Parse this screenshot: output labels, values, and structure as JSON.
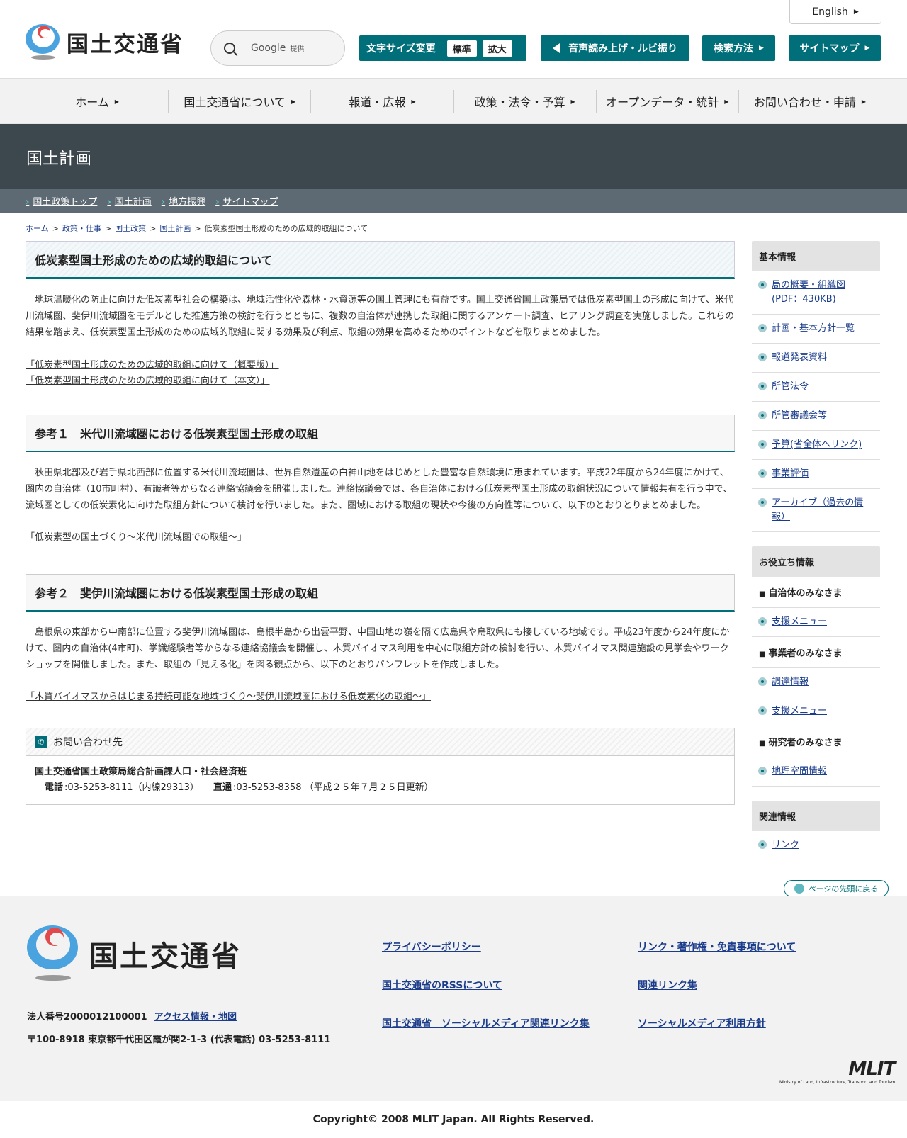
{
  "header": {
    "site_name": "国土交通省",
    "search_label": "Google",
    "search_suffix": "提供",
    "english": "English",
    "font_size_label": "文字サイズ変更",
    "font_size_std": "標準",
    "font_size_large": "拡大",
    "voice": "音声読み上げ・ルビ振り",
    "search_method": "検索方法",
    "sitemap": "サイトマップ"
  },
  "gnav": [
    "ホーム",
    "国土交通省について",
    "報道・広報",
    "政策・法令・予算",
    "オープンデータ・統計",
    "お問い合わせ・申請"
  ],
  "banner": {
    "title": "国土計画"
  },
  "subnav": [
    "国土政策トップ",
    "国土計画",
    "地方振興",
    "サイトマップ"
  ],
  "breadcrumb": {
    "items": [
      "ホーム",
      "政策・仕事",
      "国土政策",
      "国土計画"
    ],
    "current": "低炭素型国土形成のための広域的取組について",
    "sep": ">"
  },
  "main": {
    "title": "低炭素型国土形成のための広域的取組について",
    "intro": "地球温暖化の防止に向けた低炭素型社会の構築は、地域活性化や森林・水資源等の国土管理にも有益です。国土交通省国土政策局では低炭素型国土の形成に向けて、米代川流域圏、斐伊川流域圏をモデルとした推進方策の検討を行うとともに、複数の自治体が連携した取組に関するアンケート調査、ヒアリング調査を実施しました。これらの結果を踏まえ、低炭素型国土形成のための広域的取組に関する効果及び利点、取組の効果を高めるためのポイントなどを取りまとめました。",
    "link1": "「低炭素型国土形成のための広域的取組に向けて（概要版）」",
    "link2": "「低炭素型国土形成のための広域的取組に向けて（本文）」",
    "ref1_title": "参考１　米代川流域圏における低炭素型国土形成の取組",
    "ref1_text": "秋田県北部及び岩手県北西部に位置する米代川流域圏は、世界自然遺産の白神山地をはじめとした豊富な自然環境に恵まれています。平成22年度から24年度にかけて、圏内の自治体（10市町村）、有識者等からなる連絡協議会を開催しました。連絡協議会では、各自治体における低炭素型国土形成の取組状況について情報共有を行う中で、流域圏としての低炭素化に向けた取組方針について検討を行いました。また、圏域における取組の現状や今後の方向性等について、以下のとおりとりまとめました。",
    "ref1_link": "「低炭素型の国土づくり～米代川流域圏での取組～」",
    "ref2_title": "参考２　斐伊川流域圏における低炭素型国土形成の取組",
    "ref2_text": "島根県の東部から中南部に位置する斐伊川流域圏は、島根半島から出雲平野、中国山地の嶺を隔て広島県や鳥取県にも接している地域です。平成23年度から24年度にかけて、圏内の自治体(4市町)、学識経験者等からなる連絡協議会を開催し、木質バイオマス利用を中心に取組方針の検討を行い、木質バイオマス関連施設の見学会やワークショップを開催しました。また、取組の「見える化」を図る観点から、以下のとおりパンフレットを作成しました。",
    "ref2_link": "「木質バイオマスからはじまる持続可能な地域づくり～斐伊川流域圏における低炭素化の取組～」",
    "contact": {
      "title": "お問い合わせ先",
      "org": "国土交通省国土政策局総合計画課人口・社会経済班",
      "tel_label": "電話",
      "tel": ":03-5253-8111（内線29313）",
      "direct_label": "直通",
      "direct": ":03-5253-8358 （平成２５年７月２５日更新）"
    }
  },
  "sidebar": {
    "basic_title": "基本情報",
    "basic": [
      "局の概要・組織図(PDF：430KB)",
      "計画・基本方針一覧",
      "報道発表資料",
      "所管法令",
      "所管審議会等",
      "予算(省全体へリンク)",
      "事業評価",
      "アーカイブ（過去の情報）"
    ],
    "useful_title": "お役立ち情報",
    "cat_gov": "自治体のみなさま",
    "gov_link": "支援メニュー",
    "cat_biz": "事業者のみなさま",
    "biz_link1": "調達情報",
    "biz_link2": "支援メニュー",
    "cat_res": "研究者のみなさま",
    "res_link": "地理空間情報",
    "related_title": "関連情報",
    "related_link": "リンク"
  },
  "totop": "ページの先頭に戻る",
  "footer": {
    "site_name": "国土交通省",
    "corp_no": "法人番号2000012100001",
    "access": "アクセス情報・地図",
    "address": "〒100-8918 東京都千代田区霞が関2-1-3 (代表電話) 03-5253-8111",
    "col1": [
      "プライバシーポリシー",
      "国土交通省のRSSについて",
      "国土交通省　ソーシャルメディア関連リンク集"
    ],
    "col2": [
      "リンク・著作権・免責事項について",
      "関連リンク集",
      "ソーシャルメディア利用方針"
    ],
    "mlit": "MLIT",
    "mlit_sub": "Ministry of Land, Infrastructure, Transport and Tourism",
    "copyright": "Copyright© 2008 MLIT Japan. All Rights Reserved."
  },
  "colors": {
    "accent": "#006f7a",
    "banner": "#3d474e",
    "subnav": "#5d6a73"
  }
}
